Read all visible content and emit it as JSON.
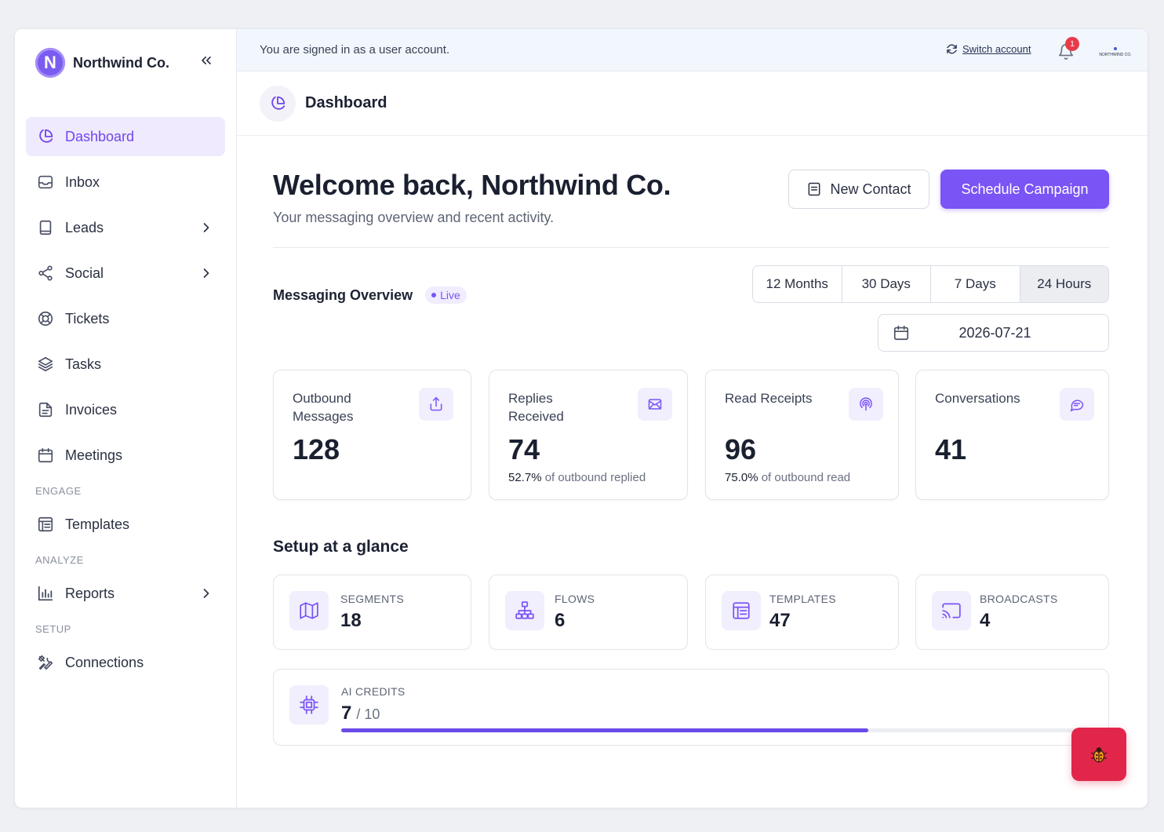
{
  "brand": {
    "name": "Northwind Co.",
    "initial": "N",
    "color": "#7a5cf0"
  },
  "sidebar": {
    "items": [
      {
        "label": "Dashboard",
        "icon": "pie-chart-icon",
        "active": true
      },
      {
        "label": "Inbox",
        "icon": "inbox-icon"
      },
      {
        "label": "Leads",
        "icon": "book-icon",
        "has_children": true
      },
      {
        "label": "Social",
        "icon": "share-icon",
        "has_children": true
      },
      {
        "label": "Tickets",
        "icon": "lifebuoy-icon"
      },
      {
        "label": "Tasks",
        "icon": "layers-icon"
      },
      {
        "label": "Invoices",
        "icon": "file-icon"
      },
      {
        "label": "Meetings",
        "icon": "calendar-icon"
      }
    ],
    "sections": [
      {
        "label": "ENGAGE",
        "items": [
          {
            "label": "Templates",
            "icon": "template-icon"
          }
        ]
      },
      {
        "label": "ANALYZE",
        "items": [
          {
            "label": "Reports",
            "icon": "bar-chart-icon",
            "has_children": true
          }
        ]
      },
      {
        "label": "SETUP",
        "items": [
          {
            "label": "Connections",
            "icon": "tools-icon"
          }
        ]
      }
    ]
  },
  "banner": {
    "text": "You are signed in as a user account.",
    "switch_label": "Switch account",
    "notification_count": "1",
    "org_logo_text": "NORTHWIND CO."
  },
  "header": {
    "title": "Dashboard"
  },
  "welcome": {
    "title": "Welcome back, Northwind Co.",
    "subtitle": "Your messaging overview and recent activity."
  },
  "actions": {
    "new_contact": "New Contact",
    "schedule": "Schedule Campaign"
  },
  "overview": {
    "title": "Messaging Overview",
    "live_label": "Live",
    "ranges": [
      "12 Months",
      "30 Days",
      "7 Days",
      "24 Hours"
    ],
    "active_range": "24 Hours",
    "date": "2026-07-21"
  },
  "stats": [
    {
      "label": "Outbound Messages",
      "value": "128",
      "icon": "share-up-icon"
    },
    {
      "label": "Replies Received",
      "value": "74",
      "sub_value": "52.7%",
      "sub_text": "of outbound replied",
      "icon": "envelope-icon"
    },
    {
      "label": "Read Receipts",
      "value": "96",
      "sub_value": "75.0%",
      "sub_text": "of outbound read",
      "icon": "broadcast-icon"
    },
    {
      "label": "Conversations",
      "value": "41",
      "icon": "chat-icon"
    }
  ],
  "setup": {
    "title": "Setup at a glance",
    "cards": [
      {
        "label": "SEGMENTS",
        "value": "18",
        "icon": "map-icon"
      },
      {
        "label": "FLOWS",
        "value": "6",
        "icon": "hierarchy-icon"
      },
      {
        "label": "TEMPLATES",
        "value": "47",
        "icon": "template-icon"
      },
      {
        "label": "BROADCASTS",
        "value": "4",
        "icon": "cast-icon"
      }
    ],
    "credits": {
      "label": "AI CREDITS",
      "value": "7",
      "total": "/ 10",
      "used": 7,
      "max": 10
    }
  },
  "fab": {
    "icon": "bug-icon",
    "color": "#e2264a"
  },
  "accent_color": "#7a54f5"
}
